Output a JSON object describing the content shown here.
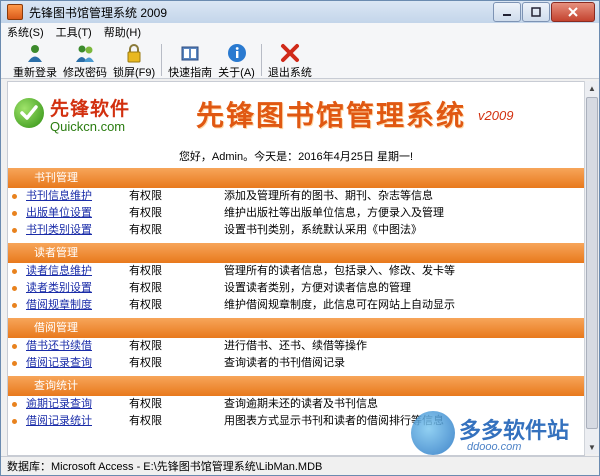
{
  "window": {
    "title": "先锋图书馆管理系统 2009"
  },
  "menu": [
    "系统(S)",
    "工具(T)",
    "帮助(H)"
  ],
  "toolbar": [
    {
      "label": "重新登录",
      "icon": "user-icon"
    },
    {
      "label": "修改密码",
      "icon": "users-icon"
    },
    {
      "label": "锁屏(F9)",
      "icon": "lock-icon"
    },
    {
      "label": "快速指南",
      "icon": "book-icon"
    },
    {
      "label": "关于(A)",
      "icon": "info-icon"
    },
    {
      "label": "退出系统",
      "icon": "exit-icon"
    }
  ],
  "logo": {
    "cn": "先锋软件",
    "en": "Quickcn.com"
  },
  "app_title": "先锋图书馆管理系统",
  "version": "v2009",
  "greeting": "您好，Admin。今天是：2016年4月25日 星期一!",
  "sections": [
    {
      "title": "书刊管理",
      "rows": [
        {
          "name": "书刊信息维护",
          "perm": "有权限",
          "desc": "添加及管理所有的图书、期刊、杂志等信息"
        },
        {
          "name": "出版单位设置",
          "perm": "有权限",
          "desc": "维护出版社等出版单位信息，方便录入及管理"
        },
        {
          "name": "书刊类别设置",
          "perm": "有权限",
          "desc": "设置书刊类别，系统默认采用《中图法》"
        }
      ]
    },
    {
      "title": "读者管理",
      "rows": [
        {
          "name": "读者信息维护",
          "perm": "有权限",
          "desc": "管理所有的读者信息，包括录入、修改、发卡等"
        },
        {
          "name": "读者类别设置",
          "perm": "有权限",
          "desc": "设置读者类别，方便对读者信息的管理"
        },
        {
          "name": "借阅规章制度",
          "perm": "有权限",
          "desc": "维护借阅规章制度，此信息可在网站上自动显示"
        }
      ]
    },
    {
      "title": "借阅管理",
      "rows": [
        {
          "name": "借书还书续借",
          "perm": "有权限",
          "desc": "进行借书、还书、续借等操作"
        },
        {
          "name": "借阅记录查询",
          "perm": "有权限",
          "desc": "查询读者的书刊借阅记录"
        }
      ]
    },
    {
      "title": "查询统计",
      "rows": [
        {
          "name": "逾期记录查询",
          "perm": "有权限",
          "desc": "查询逾期未还的读者及书刊信息"
        },
        {
          "name": "借阅记录统计",
          "perm": "有权限",
          "desc": "用图表方式显示书刊和读者的借阅排行等信息"
        }
      ]
    }
  ],
  "watermark": {
    "text": "多多软件站",
    "url": "ddooo.com"
  },
  "status": "数据库：Microsoft Access - E:\\先锋图书馆管理系统\\LibMan.MDB",
  "colors": {
    "section_bar": "#e8791c",
    "link": "#1a2ca8",
    "title": "#e05812"
  }
}
